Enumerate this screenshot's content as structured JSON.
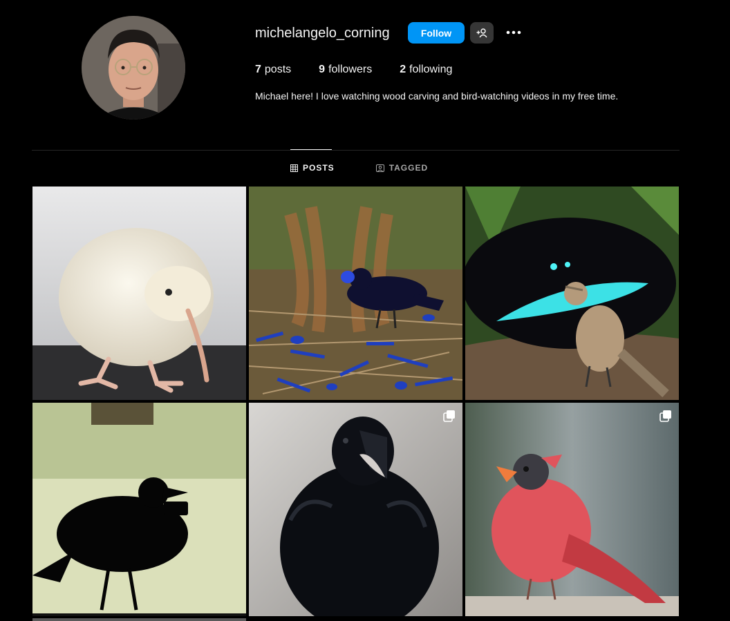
{
  "profile": {
    "username": "michelangelo_corning",
    "follow_label": "Follow",
    "stats": {
      "posts_count": "7",
      "posts_label": "posts",
      "followers_count": "9",
      "followers_label": "followers",
      "following_count": "2",
      "following_label": "following"
    },
    "bio": "Michael here! I love watching wood carving and bird-watching videos in my free time."
  },
  "tabs": [
    {
      "label": "POSTS",
      "icon": "grid-icon",
      "active": true
    },
    {
      "label": "TAGGED",
      "icon": "tagged-icon",
      "active": false
    }
  ],
  "posts": [
    {
      "subject": "white kiwi",
      "multi": false
    },
    {
      "subject": "satin bowerbird",
      "multi": false
    },
    {
      "subject": "superb bird-of-paradise",
      "multi": false
    },
    {
      "subject": "crow silhouette with camera",
      "multi": false
    },
    {
      "subject": "raven",
      "multi": true
    },
    {
      "subject": "moulting cardinal",
      "multi": true
    }
  ],
  "colors": {
    "background": "#000000",
    "accent": "#0095f6",
    "secondary_button": "#363636",
    "divider": "#262626"
  }
}
